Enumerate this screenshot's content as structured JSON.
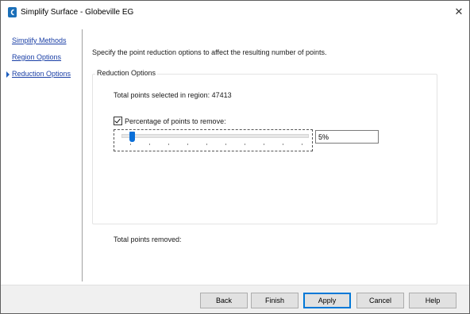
{
  "window": {
    "title": "Simplify Surface - Globeville EG",
    "close_icon": "close-icon",
    "app_icon": "civil-3d-app-icon"
  },
  "nav": {
    "items": [
      {
        "label": "Simplify Methods",
        "active": false
      },
      {
        "label": "Region Options",
        "active": false
      },
      {
        "label": "Reduction Options",
        "active": true
      }
    ],
    "active_marker_icon": "caret-right-icon"
  },
  "main": {
    "description": "Specify the point reduction options to affect the resulting number of points.",
    "group_title": "Reduction Options",
    "total_selected": "Total points selected in region: 47413",
    "percentage_checkbox": {
      "label": "Percentage of points to remove:",
      "checked": true
    },
    "percentage_slider": {
      "value_percent": 5
    },
    "percentage_value": "5%",
    "total_removed": "Total points removed:"
  },
  "buttons": {
    "back": "Back",
    "finish": "Finish",
    "apply": "Apply",
    "cancel": "Cancel",
    "help": "Help"
  },
  "colors": {
    "link": "#1a3fa6",
    "slider_thumb": "#0a6fd8",
    "default_button_border": "#0078d7"
  }
}
